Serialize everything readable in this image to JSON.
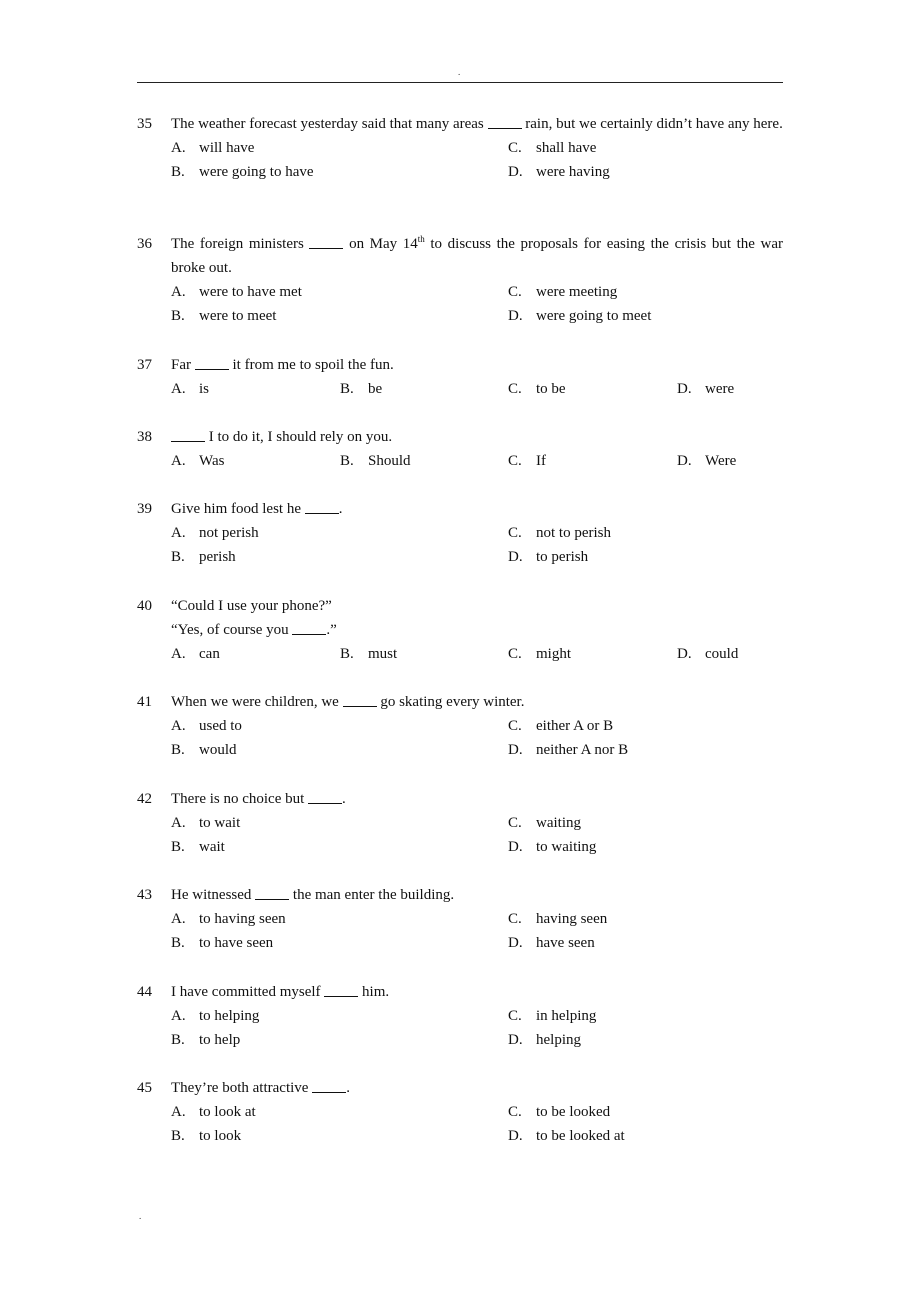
{
  "page": {
    "header_mark": ".",
    "footer_mark": "."
  },
  "questions": [
    {
      "number": "35",
      "text_before": "The weather forecast yesterday said that many areas",
      "text_after": "rain, but we certainly didn’t have any here.",
      "layout": "2col",
      "options": [
        {
          "letter": "A.",
          "text": "will have"
        },
        {
          "letter": "B.",
          "text": "were going to have"
        },
        {
          "letter": "C.",
          "text": "shall have"
        },
        {
          "letter": "D.",
          "text": "were having"
        }
      ]
    },
    {
      "number": "36",
      "text_before": "The foreign ministers",
      "text_mid": "on May 14",
      "superscript": "th",
      "text_after": "to discuss the proposals for easing the crisis but the war broke out.",
      "layout": "2col",
      "options": [
        {
          "letter": "A.",
          "text": "were to have met"
        },
        {
          "letter": "B.",
          "text": "were to meet"
        },
        {
          "letter": "C.",
          "text": "were meeting"
        },
        {
          "letter": "D.",
          "text": "were going to meet"
        }
      ]
    },
    {
      "number": "37",
      "text_before": "Far",
      "text_after": "it from me to spoil the fun.",
      "layout": "4col",
      "options": [
        {
          "letter": "A.",
          "text": "is"
        },
        {
          "letter": "B.",
          "text": "be"
        },
        {
          "letter": "C.",
          "text": "to be"
        },
        {
          "letter": "D.",
          "text": "were"
        }
      ]
    },
    {
      "number": "38",
      "text_before": "",
      "text_after": "I to do it, I should rely on you.",
      "layout": "4col",
      "options": [
        {
          "letter": "A.",
          "text": "Was"
        },
        {
          "letter": "B.",
          "text": "Should"
        },
        {
          "letter": "C.",
          "text": "If"
        },
        {
          "letter": "D.",
          "text": "Were"
        }
      ]
    },
    {
      "number": "39",
      "text_before": "Give him food lest he",
      "text_after": ".",
      "layout": "2col",
      "options": [
        {
          "letter": "A.",
          "text": "not perish"
        },
        {
          "letter": "B.",
          "text": "perish"
        },
        {
          "letter": "C.",
          "text": "not to perish"
        },
        {
          "letter": "D.",
          "text": "to perish"
        }
      ]
    },
    {
      "number": "40",
      "line1": "“Could I use your phone?”",
      "text_before": "“Yes, of course you",
      "text_after": ".”",
      "layout": "4col",
      "options": [
        {
          "letter": "A.",
          "text": "can"
        },
        {
          "letter": "B.",
          "text": "must"
        },
        {
          "letter": "C.",
          "text": "might"
        },
        {
          "letter": "D.",
          "text": "could"
        }
      ]
    },
    {
      "number": "41",
      "text_before": "When we were children, we",
      "text_after": "go skating every winter.",
      "layout": "2col",
      "options": [
        {
          "letter": "A.",
          "text": "used to"
        },
        {
          "letter": "B.",
          "text": "would"
        },
        {
          "letter": "C.",
          "text": "either A or B"
        },
        {
          "letter": "D.",
          "text": "neither A nor B"
        }
      ]
    },
    {
      "number": "42",
      "text_before": "There is no choice but",
      "text_after": ".",
      "layout": "2col",
      "options": [
        {
          "letter": "A.",
          "text": "to wait"
        },
        {
          "letter": "B.",
          "text": "wait"
        },
        {
          "letter": "C.",
          "text": "waiting"
        },
        {
          "letter": "D.",
          "text": "to waiting"
        }
      ]
    },
    {
      "number": "43",
      "text_before": "He witnessed",
      "text_after": "the man enter the building.",
      "layout": "2col",
      "options": [
        {
          "letter": "A.",
          "text": "to having seen"
        },
        {
          "letter": "B.",
          "text": "to have seen"
        },
        {
          "letter": "C.",
          "text": "having seen"
        },
        {
          "letter": "D.",
          "text": "have seen"
        }
      ]
    },
    {
      "number": "44",
      "text_before": "I have committed myself",
      "text_after": "him.",
      "layout": "2col",
      "options": [
        {
          "letter": "A.",
          "text": "to helping"
        },
        {
          "letter": "B.",
          "text": "to help"
        },
        {
          "letter": "C.",
          "text": "in helping"
        },
        {
          "letter": "D.",
          "text": "helping"
        }
      ]
    },
    {
      "number": "45",
      "text_before": "They’re both attractive",
      "text_after": ".",
      "layout": "2col",
      "options": [
        {
          "letter": "A.",
          "text": "to look at"
        },
        {
          "letter": "B.",
          "text": "to look"
        },
        {
          "letter": "C.",
          "text": "to be looked"
        },
        {
          "letter": "D.",
          "text": "to be looked at"
        }
      ]
    }
  ]
}
